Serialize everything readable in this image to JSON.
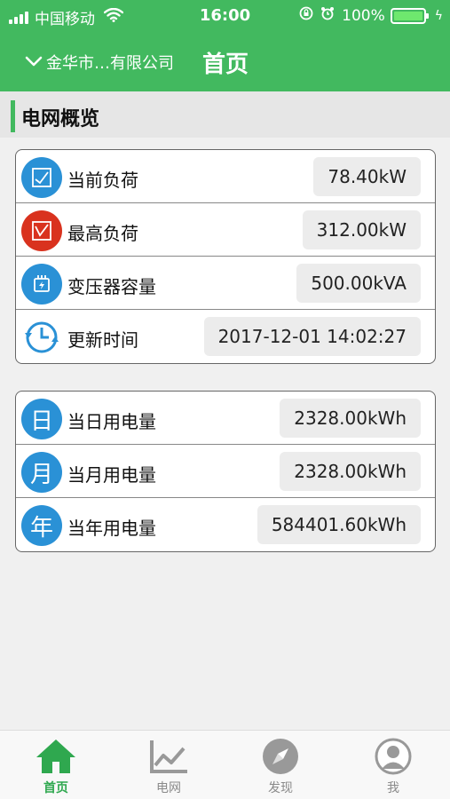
{
  "status_bar": {
    "carrier": "中国移动",
    "time": "16:00",
    "battery": "100%"
  },
  "header": {
    "company": "金华市…有限公司",
    "title": "首页"
  },
  "section": {
    "title": "电网概览"
  },
  "load_card": {
    "rows": [
      {
        "label": "当前负荷",
        "value": "78.40kW"
      },
      {
        "label": "最高负荷",
        "value": "312.00kW"
      },
      {
        "label": "变压器容量",
        "value": "500.00kVA"
      },
      {
        "label": "更新时间",
        "value": "2017-12-01 14:02:27"
      }
    ]
  },
  "energy_card": {
    "rows": [
      {
        "icon_char": "日",
        "label": "当日用电量",
        "value": "2328.00kWh"
      },
      {
        "icon_char": "月",
        "label": "当月用电量",
        "value": "2328.00kWh"
      },
      {
        "icon_char": "年",
        "label": "当年用电量",
        "value": "584401.60kWh"
      }
    ]
  },
  "tabs": [
    {
      "label": "首页"
    },
    {
      "label": "电网"
    },
    {
      "label": "发现"
    },
    {
      "label": "我"
    }
  ],
  "colors": {
    "brand_green": "#42b95f",
    "icon_blue": "#2a91d6",
    "icon_red": "#d9321e"
  }
}
